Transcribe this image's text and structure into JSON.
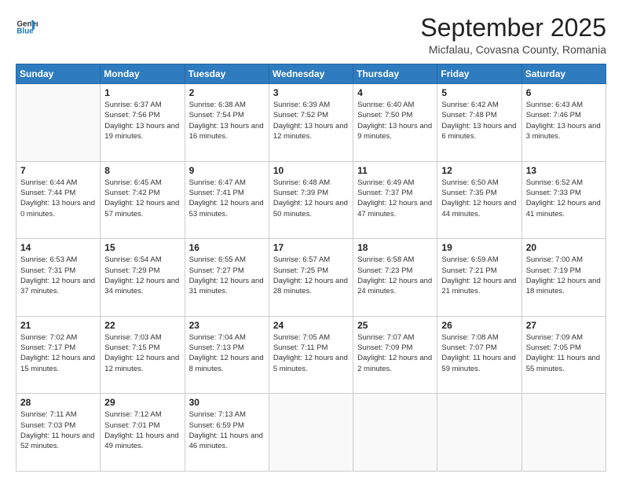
{
  "header": {
    "logo_line1": "General",
    "logo_line2": "Blue",
    "month": "September 2025",
    "location": "Micfalau, Covasna County, Romania"
  },
  "days_of_week": [
    "Sunday",
    "Monday",
    "Tuesday",
    "Wednesday",
    "Thursday",
    "Friday",
    "Saturday"
  ],
  "weeks": [
    [
      {
        "day": "",
        "empty": true
      },
      {
        "day": "1",
        "sunrise": "Sunrise: 6:37 AM",
        "sunset": "Sunset: 7:56 PM",
        "daylight": "Daylight: 13 hours and 19 minutes."
      },
      {
        "day": "2",
        "sunrise": "Sunrise: 6:38 AM",
        "sunset": "Sunset: 7:54 PM",
        "daylight": "Daylight: 13 hours and 16 minutes."
      },
      {
        "day": "3",
        "sunrise": "Sunrise: 6:39 AM",
        "sunset": "Sunset: 7:52 PM",
        "daylight": "Daylight: 13 hours and 12 minutes."
      },
      {
        "day": "4",
        "sunrise": "Sunrise: 6:40 AM",
        "sunset": "Sunset: 7:50 PM",
        "daylight": "Daylight: 13 hours and 9 minutes."
      },
      {
        "day": "5",
        "sunrise": "Sunrise: 6:42 AM",
        "sunset": "Sunset: 7:48 PM",
        "daylight": "Daylight: 13 hours and 6 minutes."
      },
      {
        "day": "6",
        "sunrise": "Sunrise: 6:43 AM",
        "sunset": "Sunset: 7:46 PM",
        "daylight": "Daylight: 13 hours and 3 minutes."
      }
    ],
    [
      {
        "day": "7",
        "sunrise": "Sunrise: 6:44 AM",
        "sunset": "Sunset: 7:44 PM",
        "daylight": "Daylight: 13 hours and 0 minutes."
      },
      {
        "day": "8",
        "sunrise": "Sunrise: 6:45 AM",
        "sunset": "Sunset: 7:42 PM",
        "daylight": "Daylight: 12 hours and 57 minutes."
      },
      {
        "day": "9",
        "sunrise": "Sunrise: 6:47 AM",
        "sunset": "Sunset: 7:41 PM",
        "daylight": "Daylight: 12 hours and 53 minutes."
      },
      {
        "day": "10",
        "sunrise": "Sunrise: 6:48 AM",
        "sunset": "Sunset: 7:39 PM",
        "daylight": "Daylight: 12 hours and 50 minutes."
      },
      {
        "day": "11",
        "sunrise": "Sunrise: 6:49 AM",
        "sunset": "Sunset: 7:37 PM",
        "daylight": "Daylight: 12 hours and 47 minutes."
      },
      {
        "day": "12",
        "sunrise": "Sunrise: 6:50 AM",
        "sunset": "Sunset: 7:35 PM",
        "daylight": "Daylight: 12 hours and 44 minutes."
      },
      {
        "day": "13",
        "sunrise": "Sunrise: 6:52 AM",
        "sunset": "Sunset: 7:33 PM",
        "daylight": "Daylight: 12 hours and 41 minutes."
      }
    ],
    [
      {
        "day": "14",
        "sunrise": "Sunrise: 6:53 AM",
        "sunset": "Sunset: 7:31 PM",
        "daylight": "Daylight: 12 hours and 37 minutes."
      },
      {
        "day": "15",
        "sunrise": "Sunrise: 6:54 AM",
        "sunset": "Sunset: 7:29 PM",
        "daylight": "Daylight: 12 hours and 34 minutes."
      },
      {
        "day": "16",
        "sunrise": "Sunrise: 6:55 AM",
        "sunset": "Sunset: 7:27 PM",
        "daylight": "Daylight: 12 hours and 31 minutes."
      },
      {
        "day": "17",
        "sunrise": "Sunrise: 6:57 AM",
        "sunset": "Sunset: 7:25 PM",
        "daylight": "Daylight: 12 hours and 28 minutes."
      },
      {
        "day": "18",
        "sunrise": "Sunrise: 6:58 AM",
        "sunset": "Sunset: 7:23 PM",
        "daylight": "Daylight: 12 hours and 24 minutes."
      },
      {
        "day": "19",
        "sunrise": "Sunrise: 6:59 AM",
        "sunset": "Sunset: 7:21 PM",
        "daylight": "Daylight: 12 hours and 21 minutes."
      },
      {
        "day": "20",
        "sunrise": "Sunrise: 7:00 AM",
        "sunset": "Sunset: 7:19 PM",
        "daylight": "Daylight: 12 hours and 18 minutes."
      }
    ],
    [
      {
        "day": "21",
        "sunrise": "Sunrise: 7:02 AM",
        "sunset": "Sunset: 7:17 PM",
        "daylight": "Daylight: 12 hours and 15 minutes."
      },
      {
        "day": "22",
        "sunrise": "Sunrise: 7:03 AM",
        "sunset": "Sunset: 7:15 PM",
        "daylight": "Daylight: 12 hours and 12 minutes."
      },
      {
        "day": "23",
        "sunrise": "Sunrise: 7:04 AM",
        "sunset": "Sunset: 7:13 PM",
        "daylight": "Daylight: 12 hours and 8 minutes."
      },
      {
        "day": "24",
        "sunrise": "Sunrise: 7:05 AM",
        "sunset": "Sunset: 7:11 PM",
        "daylight": "Daylight: 12 hours and 5 minutes."
      },
      {
        "day": "25",
        "sunrise": "Sunrise: 7:07 AM",
        "sunset": "Sunset: 7:09 PM",
        "daylight": "Daylight: 12 hours and 2 minutes."
      },
      {
        "day": "26",
        "sunrise": "Sunrise: 7:08 AM",
        "sunset": "Sunset: 7:07 PM",
        "daylight": "Daylight: 11 hours and 59 minutes."
      },
      {
        "day": "27",
        "sunrise": "Sunrise: 7:09 AM",
        "sunset": "Sunset: 7:05 PM",
        "daylight": "Daylight: 11 hours and 55 minutes."
      }
    ],
    [
      {
        "day": "28",
        "sunrise": "Sunrise: 7:11 AM",
        "sunset": "Sunset: 7:03 PM",
        "daylight": "Daylight: 11 hours and 52 minutes."
      },
      {
        "day": "29",
        "sunrise": "Sunrise: 7:12 AM",
        "sunset": "Sunset: 7:01 PM",
        "daylight": "Daylight: 11 hours and 49 minutes."
      },
      {
        "day": "30",
        "sunrise": "Sunrise: 7:13 AM",
        "sunset": "Sunset: 6:59 PM",
        "daylight": "Daylight: 11 hours and 46 minutes."
      },
      {
        "day": "",
        "empty": true
      },
      {
        "day": "",
        "empty": true
      },
      {
        "day": "",
        "empty": true
      },
      {
        "day": "",
        "empty": true
      }
    ]
  ]
}
